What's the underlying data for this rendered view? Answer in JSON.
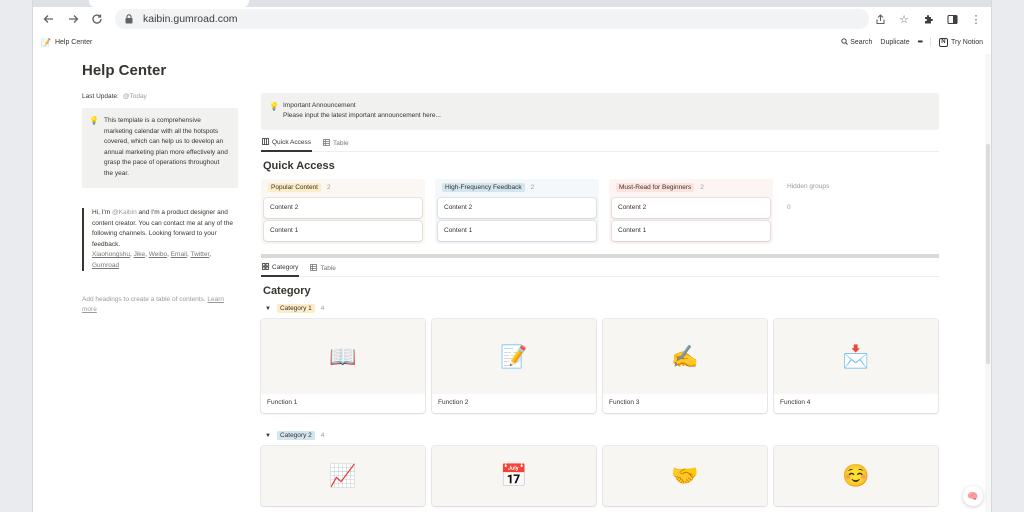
{
  "browser": {
    "url": "kaibin.gumroad.com",
    "icons": [
      "back-arrow-icon",
      "forward-arrow-icon",
      "reload-icon",
      "lock-icon",
      "share-icon",
      "star-icon",
      "extensions-icon",
      "side-panel-icon",
      "menu-icon"
    ]
  },
  "topbar": {
    "crumb_emoji": "📝",
    "crumb_label": "Help Center",
    "search": "Search",
    "duplicate": "Duplicate",
    "more": "•••",
    "try_notion": "Try Notion",
    "notion_logo": "N"
  },
  "page": {
    "title": "Help Center"
  },
  "left": {
    "last_update_label": "Last Update:",
    "last_update_value": "@Today",
    "callout_icon": "💡",
    "callout_text": "This template is a comprehensive marketing calendar with all the hotspots covered, which can help us to develop an annual marketing plan more effectively and grasp the pace of operations throughout the year.",
    "quote_prefix": "Hi, I'm ",
    "quote_mention": "@Kaibin",
    "quote_text": " and I'm a product designer and content creator. You can contact me at any of the following channels. Looking forward to your feedback.",
    "links": [
      "Xiaohongshu",
      "Jike",
      "Weibo",
      "Email",
      "Twitter",
      "Gumroad"
    ],
    "toc_hint": "Add headings to create a table of contents.",
    "toc_link": "Learn more"
  },
  "announcement": {
    "icon": "💡",
    "title": "Important Announcement",
    "text": "Please input the latest important announcement here..."
  },
  "quick_access": {
    "tabs": [
      "Quick Access",
      "Table"
    ],
    "heading": "Quick Access",
    "columns": [
      {
        "name": "Popular Content",
        "count": "2",
        "cards": [
          "Content 2",
          "Content 1"
        ],
        "color": "#fdecc8",
        "bg": "#fbf8f3"
      },
      {
        "name": "High-Frequency Feedback",
        "count": "2",
        "cards": [
          "Content 2",
          "Content 1"
        ],
        "color": "#d3e5ef",
        "bg": "#f4f8fa"
      },
      {
        "name": "Must-Read for Beginners",
        "count": "2",
        "cards": [
          "Content 2",
          "Content 1"
        ],
        "color": "#ffe2dd",
        "bg": "#fcf5f3"
      }
    ],
    "hidden_groups_label": "Hidden groups",
    "hidden_groups_count": "0"
  },
  "category": {
    "tabs": [
      "Category",
      "Table"
    ],
    "heading": "Category",
    "groups": [
      {
        "name": "Category 1",
        "count": "4",
        "color": "#fdecc8",
        "cards": [
          {
            "emoji": "📖",
            "title": "Function 1"
          },
          {
            "emoji": "📝",
            "title": "Function 2"
          },
          {
            "emoji": "✍️",
            "title": "Function 3"
          },
          {
            "emoji": "📩",
            "title": "Function 4"
          }
        ]
      },
      {
        "name": "Category 2",
        "count": "4",
        "color": "#d3e5ef",
        "cards": [
          {
            "emoji": "📈",
            "title": ""
          },
          {
            "emoji": "📅",
            "title": ""
          },
          {
            "emoji": "🤝",
            "title": ""
          },
          {
            "emoji": "☺️",
            "title": ""
          }
        ]
      }
    ]
  },
  "help_button_icon": "🧠"
}
